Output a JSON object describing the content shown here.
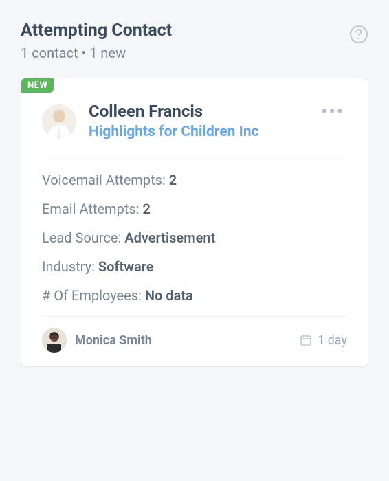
{
  "header": {
    "title": "Attempting Contact",
    "subtitle": "1 contact • 1 new"
  },
  "card": {
    "badge": "NEW",
    "contact_name": "Colleen Francis",
    "company": "Highlights for Children Inc",
    "details": [
      {
        "label": "Voicemail Attempts:",
        "value": "2"
      },
      {
        "label": "Email Attempts:",
        "value": "2"
      },
      {
        "label": "Lead Source:",
        "value": "Advertisement"
      },
      {
        "label": "Industry:",
        "value": "Software"
      },
      {
        "label": "# Of Employees:",
        "value": "No data"
      }
    ],
    "owner": "Monica Smith",
    "age": "1 day"
  }
}
